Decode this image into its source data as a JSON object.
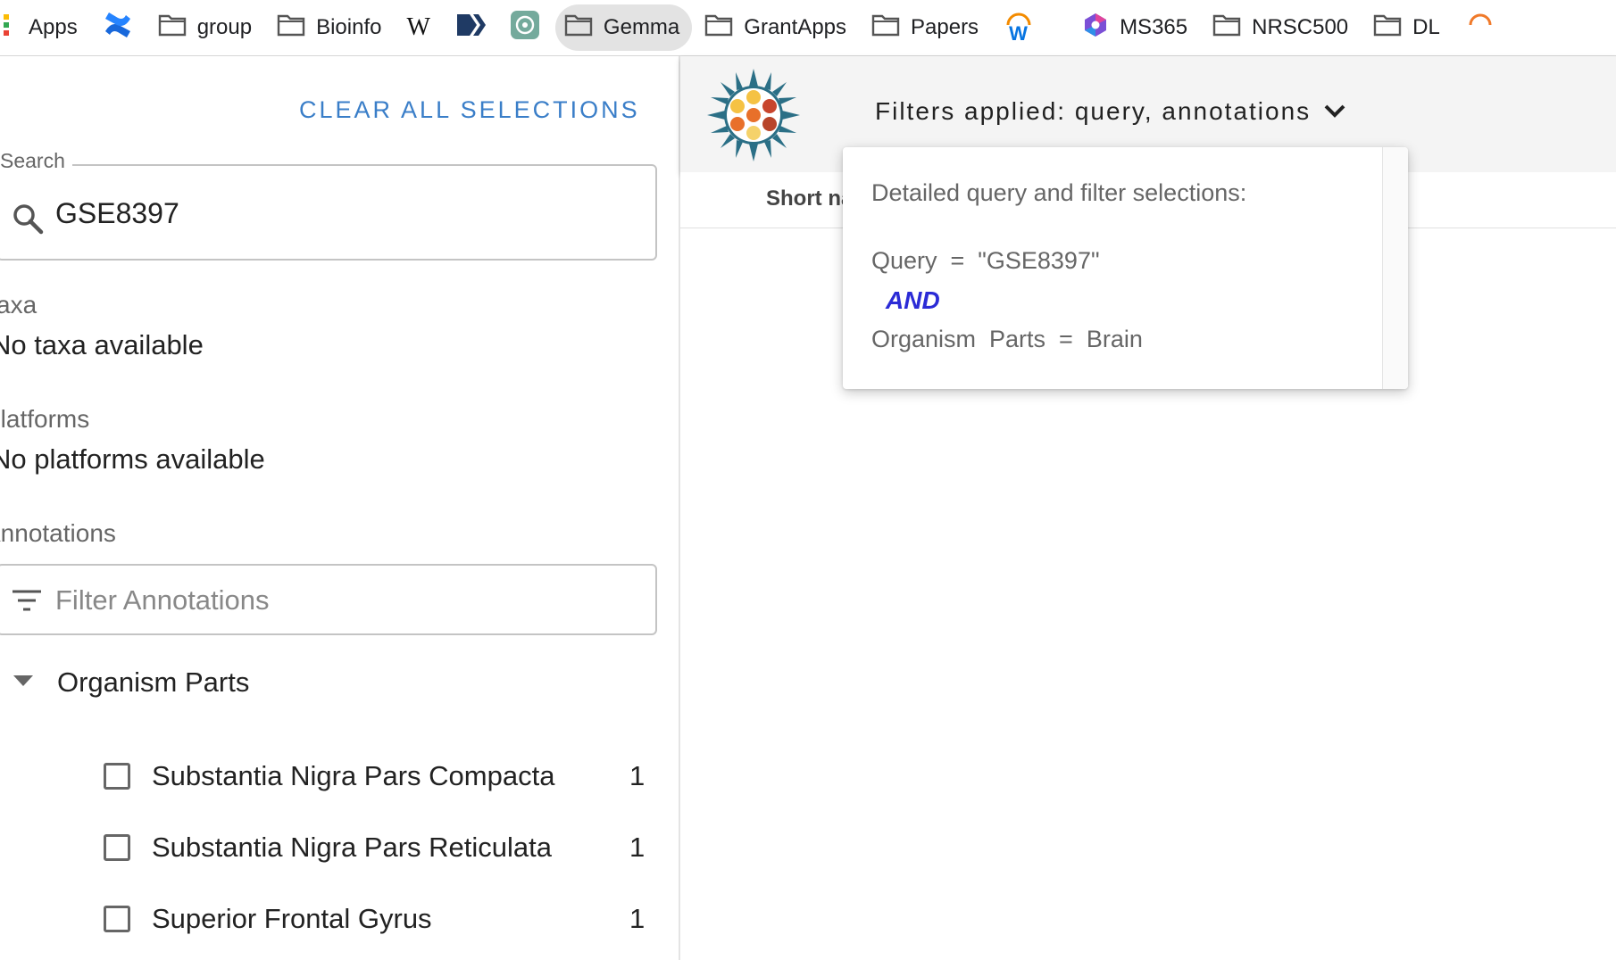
{
  "bookmarks": [
    {
      "icon": "apps-grid-icon",
      "label": "Apps"
    },
    {
      "icon": "confluence-icon",
      "label": ""
    },
    {
      "icon": "folder-icon",
      "label": "group"
    },
    {
      "icon": "folder-icon",
      "label": "Bioinfo"
    },
    {
      "icon": "wikipedia-icon",
      "label": "W"
    },
    {
      "icon": "arrow-tag-icon",
      "label": ""
    },
    {
      "icon": "chatgpt-icon",
      "label": ""
    },
    {
      "icon": "folder-icon",
      "label": "Gemma",
      "active": true
    },
    {
      "icon": "folder-icon",
      "label": "GrantApps"
    },
    {
      "icon": "folder-icon",
      "label": "Papers"
    },
    {
      "icon": "workday-icon",
      "label": "W"
    },
    {
      "icon": "ms365-icon",
      "label": "MS365"
    },
    {
      "icon": "folder-icon",
      "label": "NRSC500"
    },
    {
      "icon": "folder-icon",
      "label": "DL"
    }
  ],
  "sidebar": {
    "clear_all": "CLEAR ALL SELECTIONS",
    "search_label": "Search",
    "search_value": "GSE8397",
    "taxa_title": "Taxa",
    "taxa_empty": "No taxa available",
    "platforms_title": "Platforms",
    "platforms_empty": "No platforms available",
    "annotations_title": "Annotations",
    "filter_placeholder": "Filter Annotations",
    "group_label": "Organism Parts",
    "items": [
      {
        "label": "Substantia Nigra Pars Compacta",
        "count": "1"
      },
      {
        "label": "Substantia Nigra Pars Reticulata",
        "count": "1"
      },
      {
        "label": "Superior Frontal Gyrus",
        "count": "1"
      }
    ]
  },
  "header": {
    "filters_applied": "Filters applied: query, annotations",
    "column_short": "Short na"
  },
  "popover": {
    "title": "Detailed query and filter selections:",
    "query_line": "Query  =  \"GSE8397\"",
    "and_label": "AND",
    "filter_line": "Organism  Parts  =  Brain"
  },
  "colors": {
    "accent": "#3a7ec8",
    "and_operator": "#2b2bd6",
    "logo_teal": "#2b6f86"
  }
}
